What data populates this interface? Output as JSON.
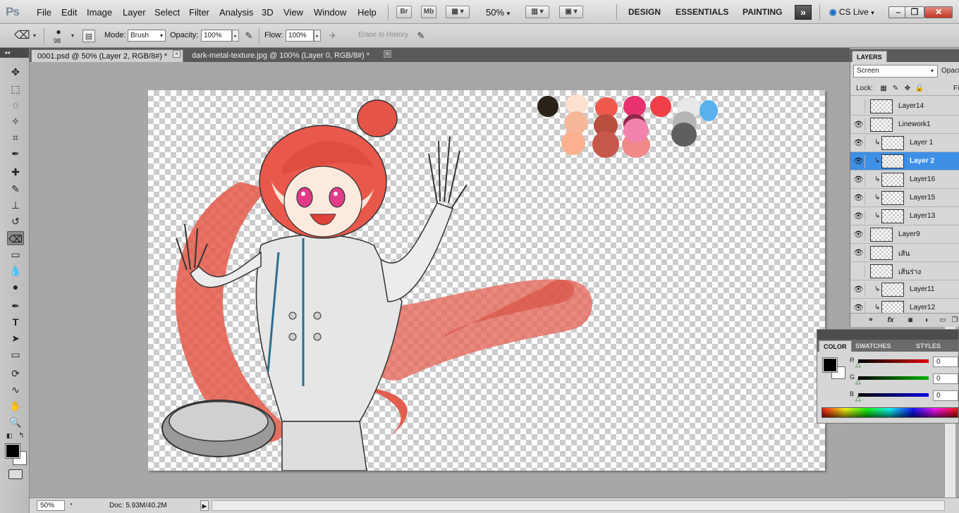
{
  "app": {
    "logo": "Ps",
    "menu": [
      "File",
      "Edit",
      "Image",
      "Layer",
      "Select",
      "Filter",
      "Analysis",
      "3D",
      "View",
      "Window",
      "Help"
    ],
    "bridge_label": "Br",
    "minibridge_label": "Mb",
    "zoom_menu": "50%",
    "workspaces": [
      "DESIGN",
      "ESSENTIALS",
      "PAINTING"
    ],
    "more_label": "»",
    "cslive": "CS Live"
  },
  "options": {
    "brush_size": "98",
    "mode_label": "Mode:",
    "mode_value": "Brush",
    "opacity_label": "Opacity:",
    "opacity_value": "100%",
    "flow_label": "Flow:",
    "flow_value": "100%",
    "erase_history_label": "Erase to History"
  },
  "tabs": [
    {
      "label": "0001.psd @ 50% (Layer 2, RGB/8#) *",
      "active": true
    },
    {
      "label": "dark-metal-texture.jpg @ 100% (Layer 0, RGB/8#) *",
      "active": false
    }
  ],
  "tab_close_glyph": "×",
  "palette_colors": [
    "#2a2218",
    "#fde0cf",
    "#f6b89a",
    "#fdb08e",
    "#ef5a4c",
    "#b84e3e",
    "#c7574a",
    "#f08a8a",
    "#e83370",
    "#8f2746",
    "#f282ae",
    "#ef3f48",
    "#e8e8e8",
    "#b5b5b5",
    "#5f5f5f",
    "#5ab1ef"
  ],
  "status": {
    "zoom": "50%",
    "doc": "Doc: 5.93M/40.2M"
  },
  "layers_panel": {
    "tabs": [
      "LAYERS"
    ],
    "blend_mode": "Screen",
    "opacity_label": "Opacit",
    "lock_label": "Lock:",
    "fill_label": "Fi",
    "layers": [
      {
        "name": "Layer14",
        "visible": false,
        "clipped": false,
        "selected": false
      },
      {
        "name": "Linework1",
        "visible": true,
        "clipped": false,
        "selected": false
      },
      {
        "name": "Layer 1",
        "visible": true,
        "clipped": true,
        "selected": false
      },
      {
        "name": "Layer 2",
        "visible": true,
        "clipped": true,
        "selected": true
      },
      {
        "name": "Layer16",
        "visible": true,
        "clipped": true,
        "selected": false
      },
      {
        "name": "Layer15",
        "visible": true,
        "clipped": true,
        "selected": false
      },
      {
        "name": "Layer13",
        "visible": true,
        "clipped": true,
        "selected": false
      },
      {
        "name": "Layer9",
        "visible": true,
        "clipped": false,
        "selected": false
      },
      {
        "name": "เส้น",
        "visible": true,
        "clipped": false,
        "selected": false
      },
      {
        "name": "เส้นร่าง",
        "visible": false,
        "clipped": false,
        "selected": false
      },
      {
        "name": "Layer11",
        "visible": true,
        "clipped": true,
        "selected": false
      },
      {
        "name": "Layer12",
        "visible": true,
        "clipped": true,
        "selected": false
      }
    ],
    "footer_icons": [
      "link-icon",
      "fx-icon",
      "mask-icon",
      "adjustment-icon",
      "group-icon",
      "new-layer-icon",
      "trash-icon"
    ]
  },
  "color_panel": {
    "tabs": [
      "COLOR",
      "SWATCHES",
      "STYLES"
    ],
    "channels": [
      {
        "label": "R",
        "value": "0",
        "color": "#e00000"
      },
      {
        "label": "G",
        "value": "0",
        "color": "#00b000"
      },
      {
        "label": "B",
        "value": "0",
        "color": "#0000e0"
      }
    ]
  },
  "colors": {
    "selected_layer": "#3e8fe6",
    "foreground": "#000000",
    "background": "#ffffff"
  }
}
